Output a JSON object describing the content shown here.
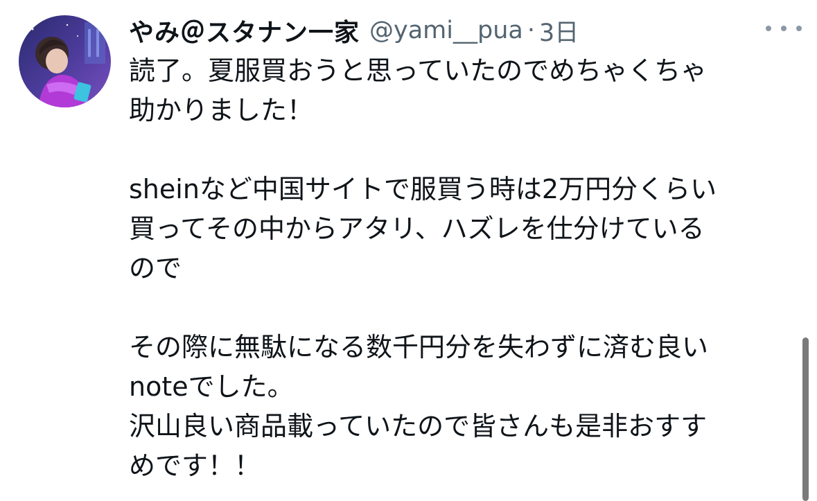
{
  "user": {
    "display_name": "やみ＠スタナン一家",
    "handle": "@yami__pua",
    "separator": "·",
    "timestamp": "3日"
  },
  "icons": {
    "more": "more-horizontal-icon",
    "avatar": "avatar-image"
  },
  "colors": {
    "text": "#0f1419",
    "secondary": "#536471",
    "avatar_bg": "#3b2e7e"
  },
  "tweet": {
    "lines_para1": [
      "読了。夏服買おうと思っていたのでめちゃくちゃ",
      "助かりました！"
    ],
    "lines_para2": [
      "sheinなど中国サイトで服買う時は2万円分くらい",
      "買ってその中からアタリ、ハズレを仕分けている",
      "ので"
    ],
    "lines_para3": [
      "その際に無駄になる数千円分を失わずに済む良い",
      "noteでした。",
      "沢山良い商品載っていたので皆さんも是非おすす",
      "めです！！"
    ]
  }
}
